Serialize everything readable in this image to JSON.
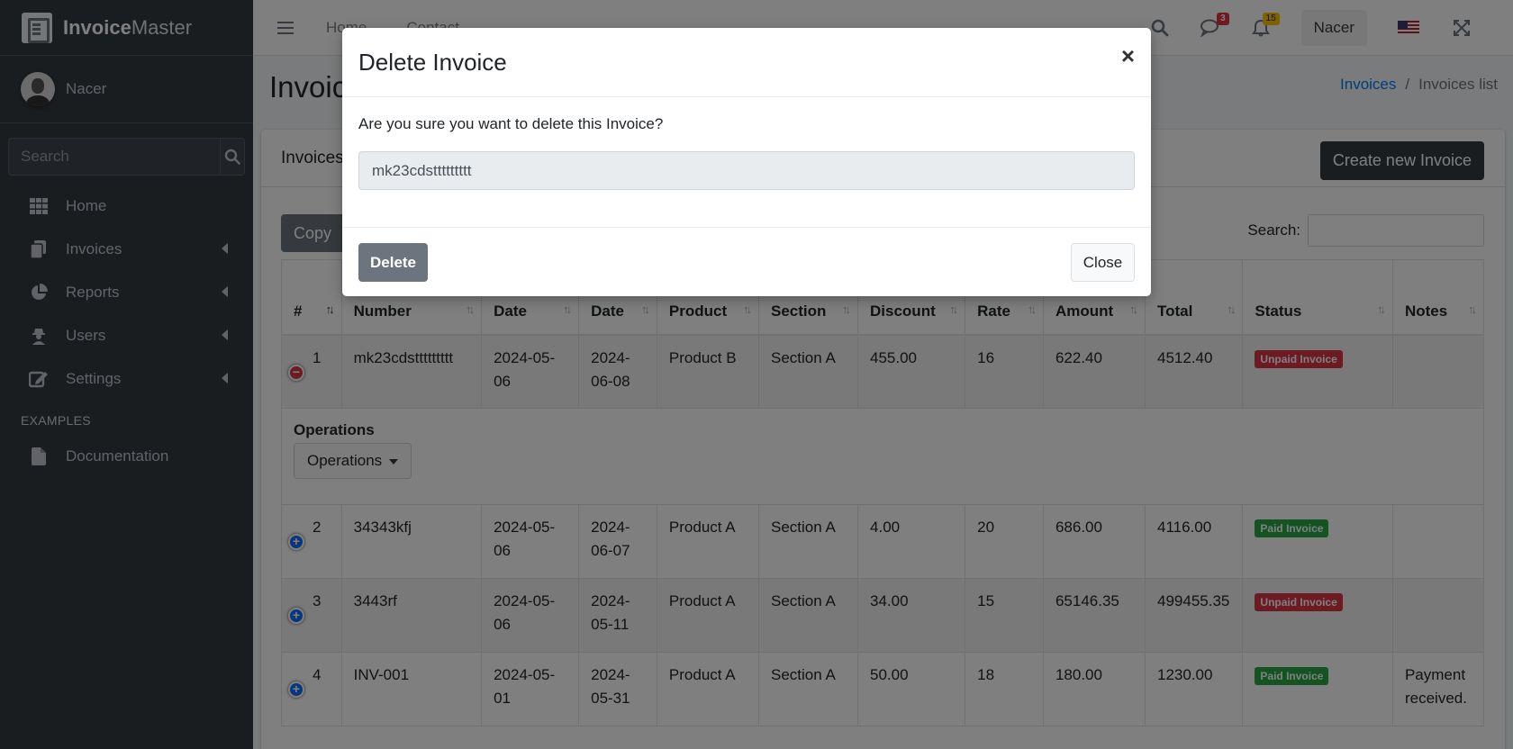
{
  "brand": {
    "bold": "Invoice",
    "light": "Master"
  },
  "user": {
    "name": "Nacer"
  },
  "sidebar": {
    "search_placeholder": "Search",
    "items": [
      {
        "label": "Home",
        "icon": "table-icon"
      },
      {
        "label": "Invoices",
        "icon": "copy-icon"
      },
      {
        "label": "Reports",
        "icon": "chart-pie-icon"
      },
      {
        "label": "Users",
        "icon": "user-secret-icon"
      },
      {
        "label": "Settings",
        "icon": "edit-icon"
      }
    ],
    "examples_header": "EXAMPLES",
    "examples": [
      {
        "label": "Documentation",
        "icon": "file-icon"
      }
    ]
  },
  "navbar": {
    "links": [
      "Home",
      "Contact"
    ],
    "messages_count": "3",
    "notifications_count": "15",
    "user": "Nacer",
    "colors": {
      "messages_badge": "#dc3545",
      "notifications_badge": "#ffc107"
    }
  },
  "page": {
    "title": "Invoices list",
    "breadcrumb": {
      "link": "Invoices",
      "sep": "/",
      "active": "Invoices list"
    }
  },
  "card": {
    "title": "Invoices",
    "create_button": "Create new Invoice",
    "copy_button": "Copy",
    "search_label": "Search:"
  },
  "table": {
    "headers": [
      "#",
      "Number",
      "Date",
      "Date",
      "Product",
      "Section",
      "Discount",
      "Rate",
      "Amount",
      "Total",
      "Status",
      "Notes"
    ],
    "rows": [
      {
        "n": "1",
        "number": "mk23cdsttttttttt",
        "date1": "2024-05-06",
        "date2": "2024-06-08",
        "product": "Product B",
        "section": "Section A",
        "discount": "455.00",
        "rate": "16",
        "amount": "622.40",
        "total": "4512.40",
        "status": "Unpaid Invoice",
        "notes": ""
      },
      {
        "n": "2",
        "number": "34343kfj",
        "date1": "2024-05-06",
        "date2": "2024-06-07",
        "product": "Product A",
        "section": "Section A",
        "discount": "4.00",
        "rate": "20",
        "amount": "686.00",
        "total": "4116.00",
        "status": "Paid Invoice",
        "notes": ""
      },
      {
        "n": "3",
        "number": "3443rf",
        "date1": "2024-05-06",
        "date2": "2024-05-11",
        "product": "Product A",
        "section": "Section A",
        "discount": "34.00",
        "rate": "15",
        "amount": "65146.35",
        "total": "499455.35",
        "status": "Unpaid Invoice",
        "notes": ""
      },
      {
        "n": "4",
        "number": "INV-001",
        "date1": "2024-05-01",
        "date2": "2024-05-31",
        "product": "Product A",
        "section": "Section A",
        "discount": "50.00",
        "rate": "18",
        "amount": "180.00",
        "total": "1230.00",
        "status": "Paid Invoice",
        "notes": "Payment received."
      }
    ],
    "child_row": {
      "label": "Operations",
      "button": "Operations"
    }
  },
  "modal": {
    "title": "Delete Invoice",
    "close_symbol": "×",
    "message": "Are you sure you want to delete this Invoice?",
    "invoice_number": "mk23cdsttttttttt",
    "delete_button": "Delete",
    "close_button": "Close"
  },
  "colors": {
    "sidebar": "#343a40",
    "unpaid": "#dc3545",
    "paid": "#28a745",
    "link": "#007bff"
  }
}
